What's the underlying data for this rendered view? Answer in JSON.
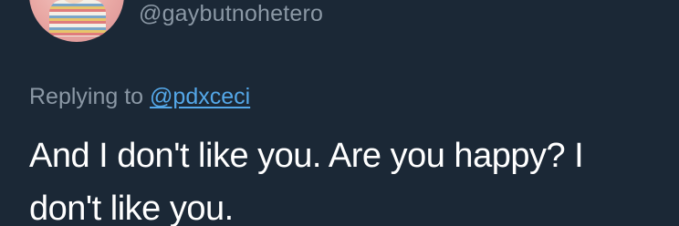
{
  "tweet": {
    "handle": "@gaybutnohetero",
    "replying_prefix": "Replying to",
    "replying_to": "@pdxceci",
    "text": "And I don't like you. Are you happy? I don't like you."
  },
  "colors": {
    "background": "#1b2836",
    "muted_text": "#8b98a5",
    "link": "#54a7e8",
    "body_text": "#ffffff"
  }
}
